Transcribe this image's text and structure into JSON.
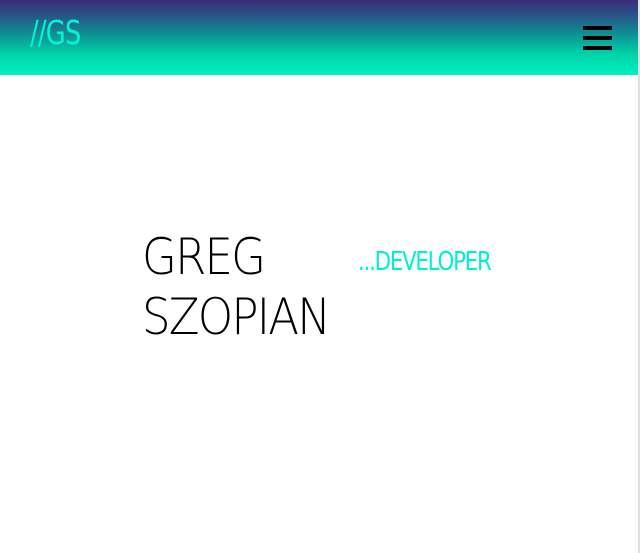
{
  "header": {
    "logo_text": "//GS",
    "menu_icon": "hamburger-menu-icon"
  },
  "hero": {
    "name_line1": "GREG",
    "name_line2": "SZOPIAN",
    "role": "...DEVELOPER"
  },
  "colors": {
    "header_gradient_top": "#3d2a78",
    "header_gradient_bottom": "#00f0c0",
    "accent": "#00f0d4",
    "text": "#000000",
    "background": "#ffffff"
  }
}
